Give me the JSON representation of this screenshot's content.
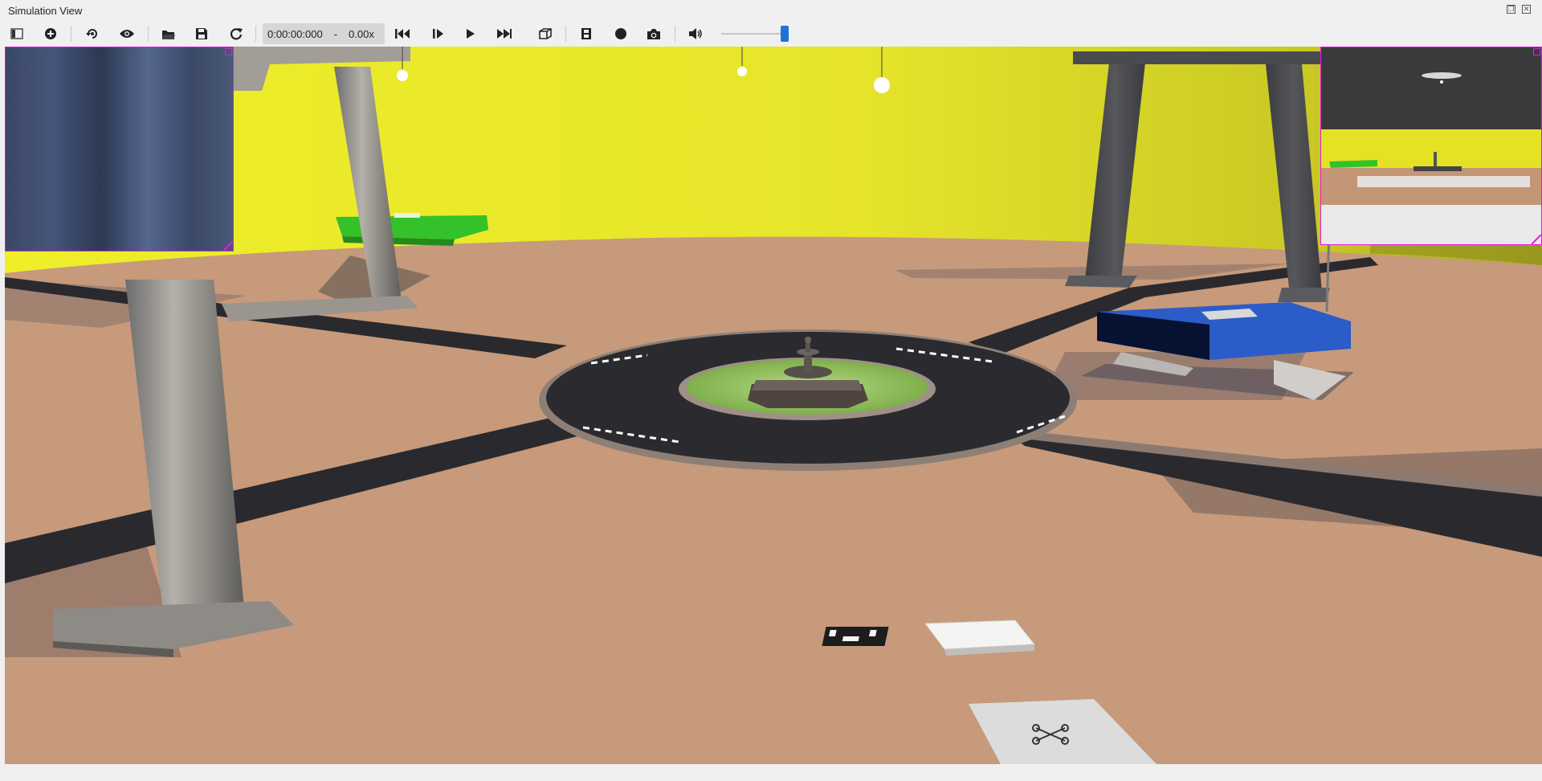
{
  "window": {
    "title": "Simulation View"
  },
  "toolbar": {
    "time": "0:00:00:000",
    "separator": "-",
    "speed": "0.00x",
    "volume_level_fraction": 0.95,
    "buttons": [
      {
        "name": "toggle-scene-tree-button",
        "icon": "sidebar-icon"
      },
      {
        "name": "add-object-button",
        "icon": "plus-circle-icon"
      },
      {
        "name": "reset-view-button",
        "icon": "rotate-view-icon"
      },
      {
        "name": "show-hide-button",
        "icon": "eye-icon"
      },
      {
        "name": "open-world-button",
        "icon": "folder-icon"
      },
      {
        "name": "save-world-button",
        "icon": "save-icon"
      },
      {
        "name": "reload-world-button",
        "icon": "reload-icon"
      },
      {
        "name": "reset-simulation-button",
        "icon": "skip-back-icon"
      },
      {
        "name": "step-button",
        "icon": "step-icon"
      },
      {
        "name": "play-button",
        "icon": "play-icon"
      },
      {
        "name": "fast-forward-button",
        "icon": "fast-forward-icon"
      },
      {
        "name": "view-3d-button",
        "icon": "cube-icon"
      },
      {
        "name": "record-movie-button",
        "icon": "film-icon"
      },
      {
        "name": "record-button",
        "icon": "record-icon"
      },
      {
        "name": "screenshot-button",
        "icon": "camera-icon"
      },
      {
        "name": "mute-button",
        "icon": "speaker-icon"
      }
    ]
  },
  "scene": {
    "sky_color": "#e8e62a",
    "floor_color": "#c69a7b",
    "road_color": "#2a2a2e",
    "table_colors": [
      "#35c12a",
      "#2c5cc7"
    ]
  }
}
